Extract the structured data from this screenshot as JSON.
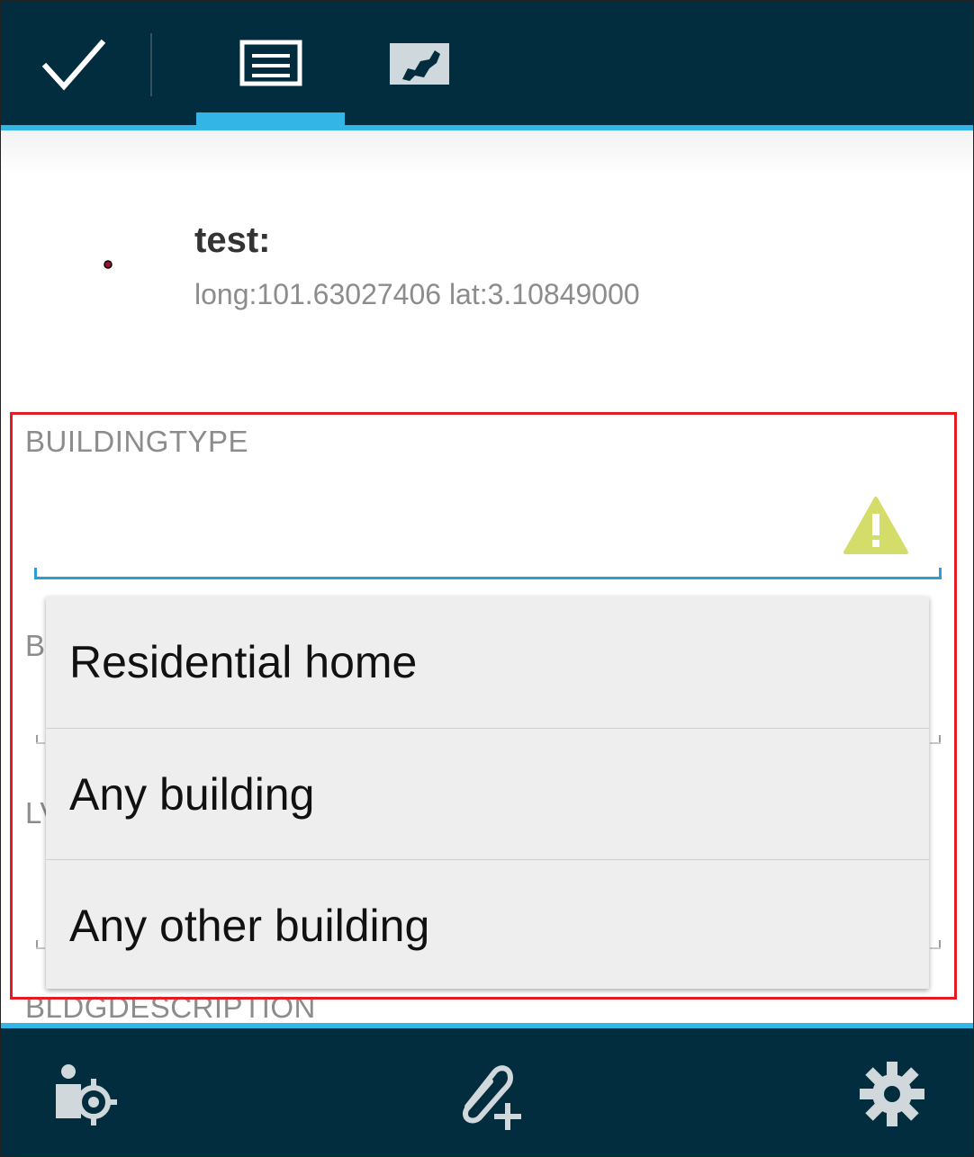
{
  "toolbar": {
    "check_icon": "check-icon",
    "form_tab_icon": "form-list-icon",
    "map_tab_icon": "map-icon",
    "accent_color": "#33b5e5",
    "bar_color": "#022d3f"
  },
  "header": {
    "title": "test:",
    "coords": "long:101.63027406 lat:3.10849000"
  },
  "form": {
    "building_type_label": "BUILDINGTYPE",
    "field_b_label_visible": "B",
    "field_lv_label_visible": "LV",
    "field_desc_label_visible": "BLDGDESCRIPTION",
    "warning_icon": "warning-icon",
    "warning_color": "#d4dc6a"
  },
  "dropdown": {
    "options": [
      "Residential home",
      "Any building",
      "Any other building"
    ]
  },
  "bottombar": {
    "gps_icon": "gps-user-icon",
    "attach_icon": "attach-add-icon",
    "settings_icon": "settings-gear-icon"
  },
  "highlight_color": "#e31b23"
}
